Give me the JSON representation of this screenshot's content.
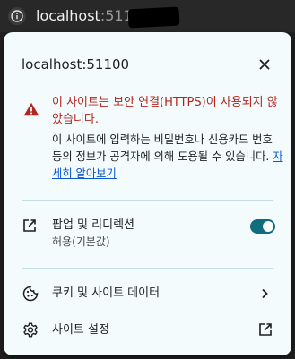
{
  "omnibox": {
    "host": "localhost",
    "port": ":51100/",
    "site_info_icon": "info-icon"
  },
  "popup": {
    "title": "localhost:51100",
    "close_icon": "close-icon",
    "warning": {
      "icon": "warning-triangle-icon",
      "title": "이 사이트는 보안 연결(HTTPS)이 사용되지 않았습니다.",
      "body": "이 사이트에 입력하는 비밀번호나 신용카드 번호 등의 정보가 공격자에 의해 도용될 수 있습니다.",
      "link": "자세히 알아보기"
    },
    "permission": {
      "icon": "open-in-new-icon",
      "label": "팝업 및 리디렉션",
      "sublabel": "허용(기본값)",
      "enabled": true
    },
    "cookies": {
      "icon": "cookie-icon",
      "label": "쿠키 및 사이트 데이터",
      "trailing_icon": "chevron-right-icon"
    },
    "settings": {
      "icon": "gear-icon",
      "label": "사이트 설정",
      "trailing_icon": "external-link-icon"
    }
  },
  "colors": {
    "popup_bg": "#f3fbfd",
    "warning": "#b3261e",
    "link": "#0b57d0",
    "toggle_on": "#0f6d7e",
    "divider": "#c4dde2"
  }
}
